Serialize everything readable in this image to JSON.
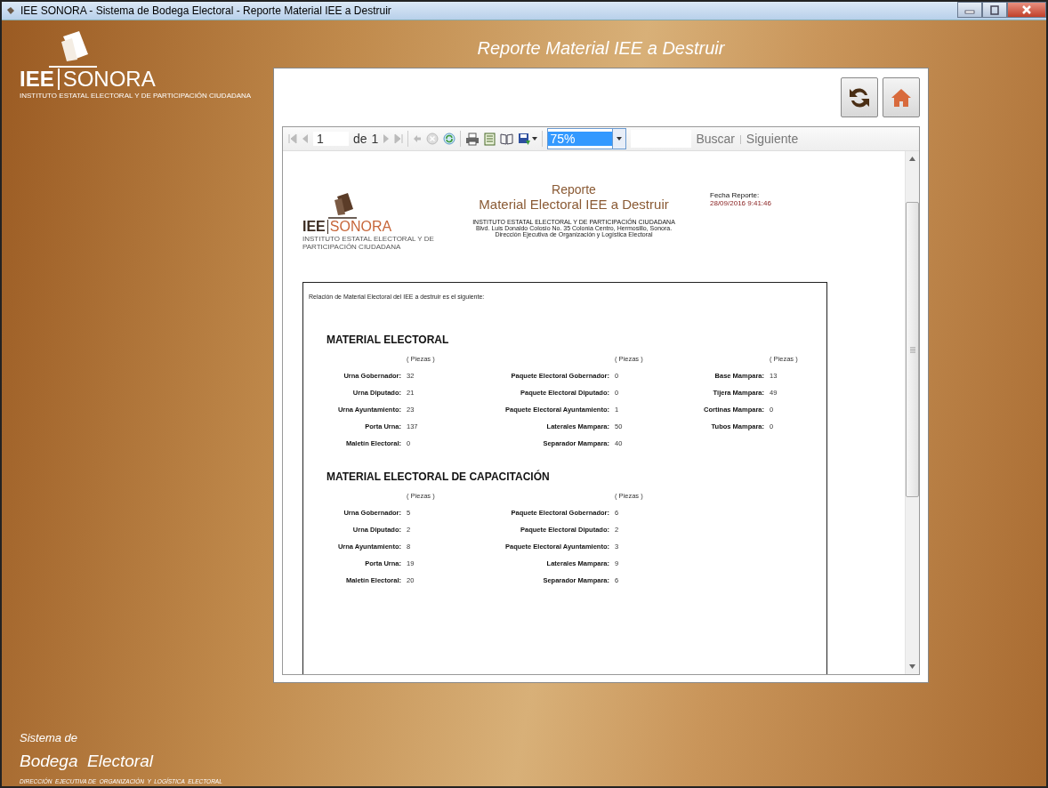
{
  "window": {
    "title": "IEE SONORA - Sistema de Bodega Electoral - Reporte Material IEE a Destruir"
  },
  "logo": {
    "wordmark_left": "IEE",
    "wordmark_right": "SONORA",
    "tagline": "INSTITUTO ESTATAL ELECTORAL Y DE PARTICIPACIÓN CIUDADANA"
  },
  "page_title": "Reporte Material IEE a Destruir",
  "toolbar": {
    "page": "1",
    "of_label": "de",
    "page_count": "1",
    "zoom": "75%",
    "zoom_selected": true,
    "find_label": "Buscar",
    "separator": "|",
    "next_label": "Siguiente"
  },
  "report": {
    "logo": {
      "wordmark_left": "IEE",
      "wordmark_right": "SONORA",
      "tagline": "INSTITUTO ESTATAL ELECTORAL Y DE PARTICIPACIÓN CIUDADANA"
    },
    "title": "Reporte",
    "subtitle": "Material Electoral IEE a Destruir",
    "institution": "INSTITUTO ESTATAL ELECTORAL Y DE PARTICIPACIÓN CIUDADANA",
    "address": "Blvd. Luis Donaldo Colosio No. 35 Colonia Centro, Hermosillo, Sonora.",
    "department": "Dirección Ejecutiva de Organización y Logística Electoral",
    "date_label": "Fecha Reporte:",
    "date": "28/09/2016 9:41:46",
    "intro": "Relación de Material Electoral del IEE a destruir es el siguiente:",
    "sections": [
      {
        "title": "MATERIAL ELECTORAL",
        "columns": [
          {
            "unit": "( Piezas )",
            "items": [
              {
                "label": "Urna Gobernador:",
                "value": "32"
              },
              {
                "label": "Urna Diputado:",
                "value": "21"
              },
              {
                "label": "Urna Ayuntamiento:",
                "value": "23"
              },
              {
                "label": "Porta Urna:",
                "value": "137"
              },
              {
                "label": "Maletín Electoral:",
                "value": "0"
              }
            ]
          },
          {
            "unit": "( Piezas )",
            "items": [
              {
                "label": "Paquete Electoral Gobernador:",
                "value": "0"
              },
              {
                "label": "Paquete Electoral Diputado:",
                "value": "0"
              },
              {
                "label": "Paquete Electoral Ayuntamiento:",
                "value": "1"
              },
              {
                "label": "Laterales Mampara:",
                "value": "50"
              },
              {
                "label": "Separador Mampara:",
                "value": "40"
              }
            ]
          },
          {
            "unit": "( Piezas )",
            "items": [
              {
                "label": "Base Mampara:",
                "value": "13"
              },
              {
                "label": "Tijera Mampara:",
                "value": "49"
              },
              {
                "label": "Cortinas Mampara:",
                "value": "0"
              },
              {
                "label": "Tubos Mampara:",
                "value": "0"
              }
            ]
          }
        ]
      },
      {
        "title": "MATERIAL ELECTORAL DE CAPACITACIÓN",
        "columns": [
          {
            "unit": "( Piezas )",
            "items": [
              {
                "label": "Urna Gobernador:",
                "value": "5"
              },
              {
                "label": "Urna Diputado:",
                "value": "2"
              },
              {
                "label": "Urna Ayuntamiento:",
                "value": "8"
              },
              {
                "label": "Porta Urna:",
                "value": "19"
              },
              {
                "label": "Maletín Electoral:",
                "value": "20"
              }
            ]
          },
          {
            "unit": "( Piezas )",
            "items": [
              {
                "label": "Paquete Electoral Gobernador:",
                "value": "6"
              },
              {
                "label": "Paquete Electoral Diputado:",
                "value": "2"
              },
              {
                "label": "Paquete Electoral Ayuntamiento:",
                "value": "3"
              },
              {
                "label": "Laterales Mampara:",
                "value": "9"
              },
              {
                "label": "Separador Mampara:",
                "value": "6"
              }
            ]
          }
        ]
      }
    ]
  },
  "footer": {
    "line1": "Sistema de",
    "line2": "Bodega  Electoral",
    "line3": "DIRECCIÓN  EJECUTIVA DE  ORGANIZACIÓN  Y  LOGÍSTICA  ELECTORAL"
  }
}
